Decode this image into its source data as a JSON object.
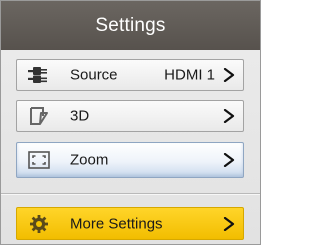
{
  "header": {
    "title": "Settings"
  },
  "menu": {
    "items": [
      {
        "id": "source",
        "label": "Source",
        "value": "HDMI 1",
        "icon": "source-input-icon"
      },
      {
        "id": "3d",
        "label": "3D",
        "value": "",
        "icon": "3d-icon"
      },
      {
        "id": "zoom",
        "label": "Zoom",
        "value": "",
        "icon": "zoom-frame-icon",
        "highlighted": true
      },
      {
        "id": "more_settings",
        "label": "More Settings",
        "value": "",
        "icon": "gear-icon",
        "selected": true
      }
    ]
  },
  "colors": {
    "header_bg": "#5f5a55",
    "selected_bg": "#f5c400",
    "highlight_bg": "#dbe6f3",
    "panel_bg": "#e6e6e6"
  }
}
